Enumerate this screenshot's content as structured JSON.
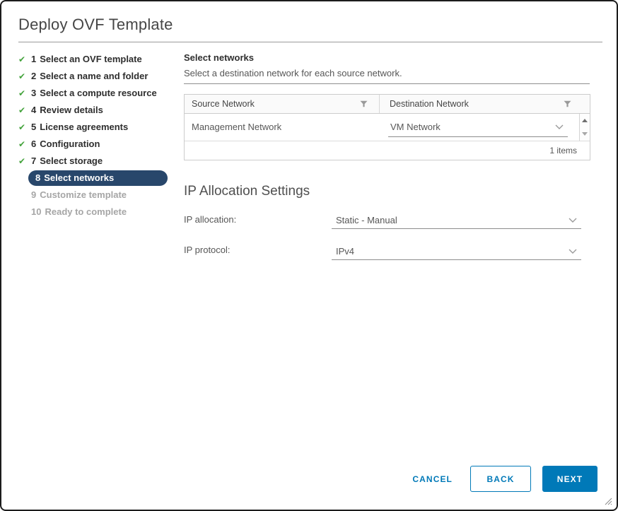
{
  "window": {
    "title": "Deploy OVF Template"
  },
  "steps": [
    {
      "num": "1",
      "label": "Select an OVF template",
      "state": "done"
    },
    {
      "num": "2",
      "label": "Select a name and folder",
      "state": "done"
    },
    {
      "num": "3",
      "label": "Select a compute resource",
      "state": "done"
    },
    {
      "num": "4",
      "label": "Review details",
      "state": "done"
    },
    {
      "num": "5",
      "label": "License agreements",
      "state": "done"
    },
    {
      "num": "6",
      "label": "Configuration",
      "state": "done"
    },
    {
      "num": "7",
      "label": "Select storage",
      "state": "done"
    },
    {
      "num": "8",
      "label": "Select networks",
      "state": "active"
    },
    {
      "num": "9",
      "label": "Customize template",
      "state": "pending"
    },
    {
      "num": "10",
      "label": "Ready to complete",
      "state": "pending"
    }
  ],
  "panel": {
    "heading": "Select networks",
    "subheading": "Select a destination network for each source network.",
    "network_table": {
      "columns": [
        {
          "label": "Source Network"
        },
        {
          "label": "Destination Network"
        }
      ],
      "rows": [
        {
          "source": "Management Network",
          "destination": "VM Network"
        }
      ],
      "count_label": "1 items"
    },
    "ip_allocation": {
      "heading": "IP Allocation Settings",
      "fields": [
        {
          "label": "IP allocation:",
          "value": "Static - Manual"
        },
        {
          "label": "IP protocol:",
          "value": "IPv4"
        }
      ]
    }
  },
  "actions": {
    "cancel": "CANCEL",
    "back": "BACK",
    "next": "NEXT"
  },
  "icons": {
    "checkmark": "✔"
  },
  "colors": {
    "accent_blue": "#0079B8",
    "active_step_bg": "#28476B",
    "checkmark_green": "#44A33C"
  }
}
